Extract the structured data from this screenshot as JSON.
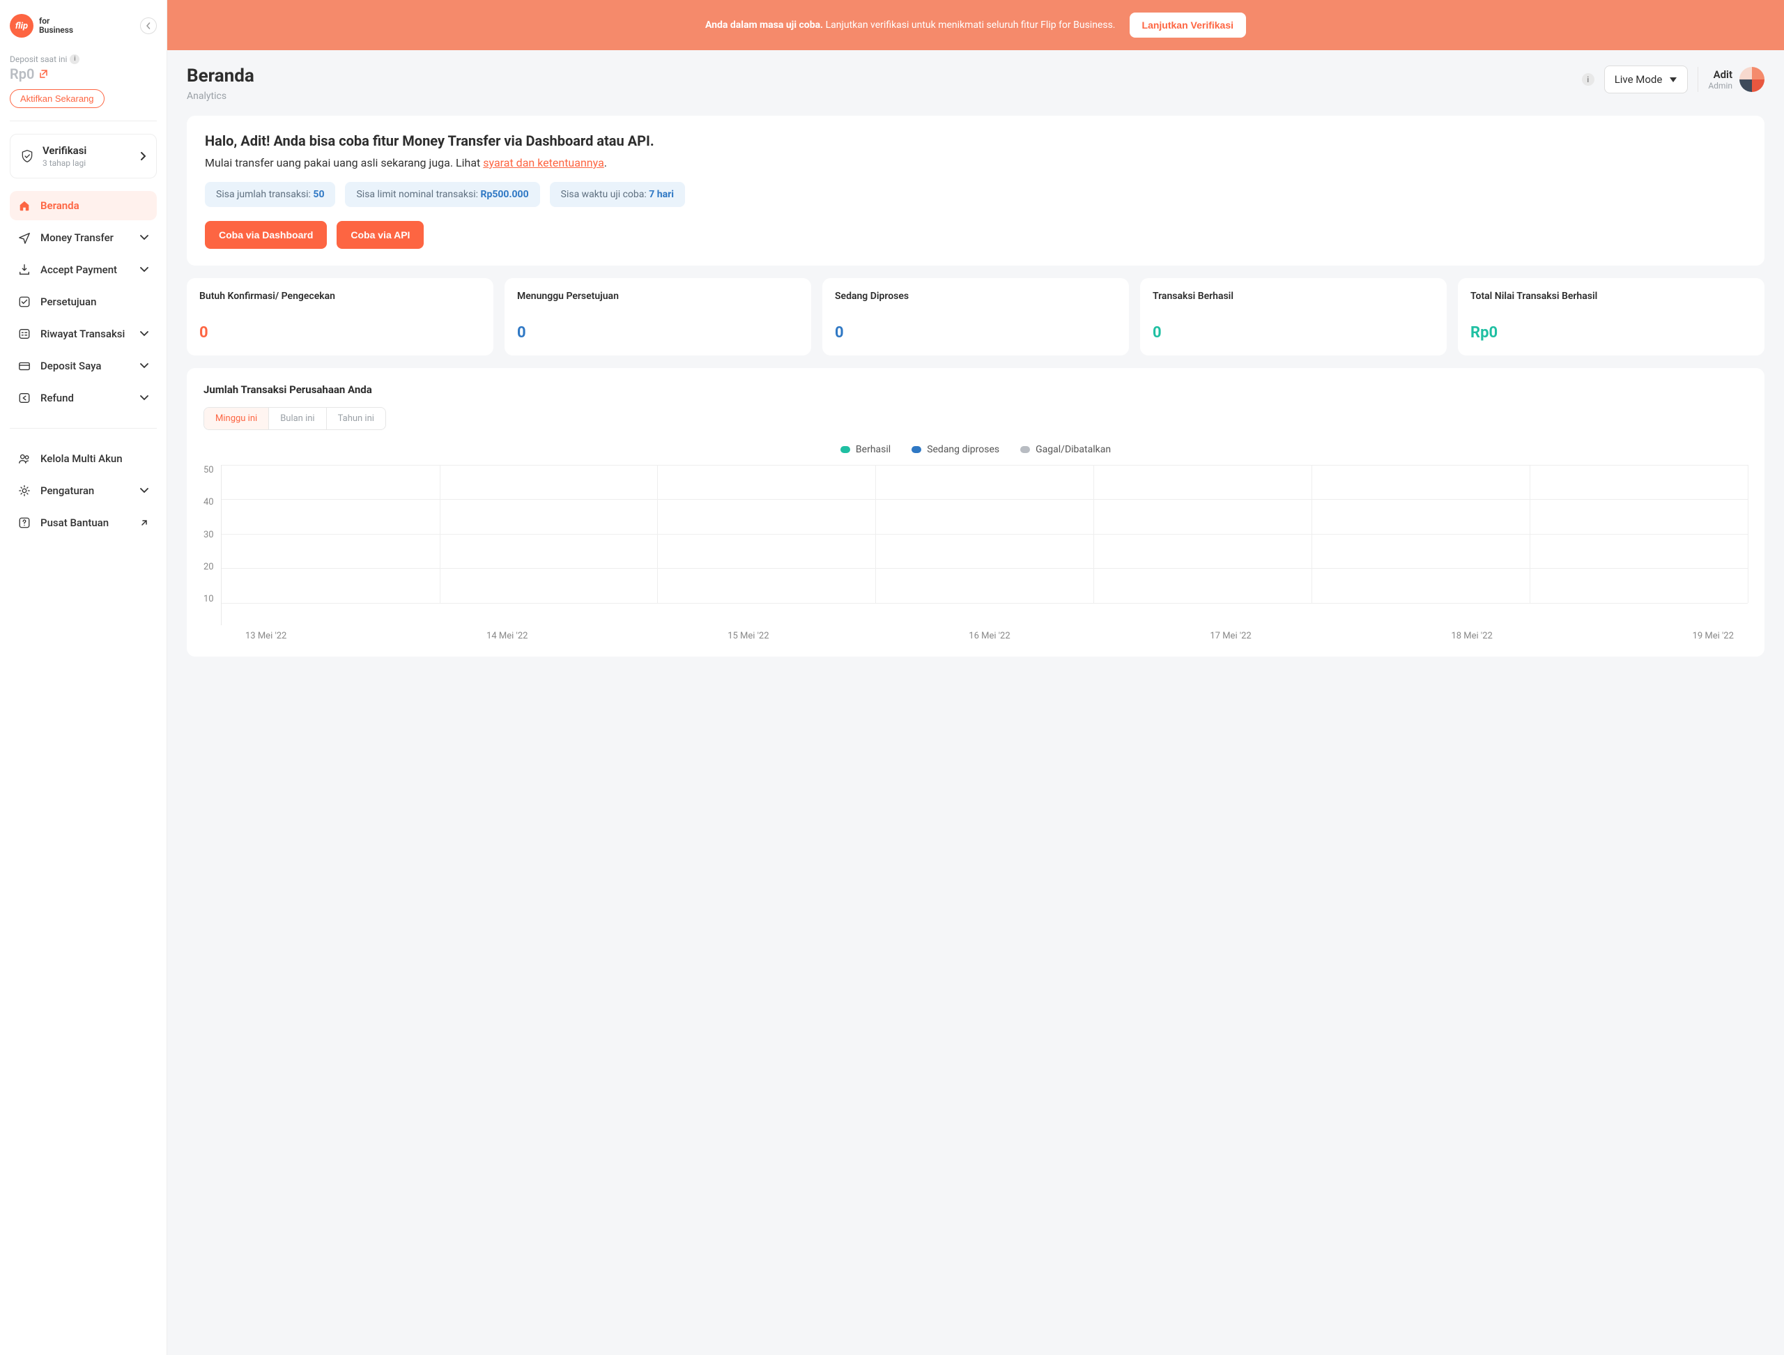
{
  "logo": {
    "badge": "flip",
    "line1": "for",
    "line2": "Business"
  },
  "deposit": {
    "label": "Deposit saat ini",
    "value": "Rp0",
    "activate": "Aktifkan Sekarang"
  },
  "verification": {
    "title": "Verifikasi",
    "subtitle": "3 tahap lagi"
  },
  "nav": {
    "beranda": "Beranda",
    "money": "Money Transfer",
    "accept": "Accept Payment",
    "approval": "Persetujuan",
    "history": "Riwayat Transaksi",
    "deposit": "Deposit Saya",
    "refund": "Refund",
    "multi": "Kelola Multi Akun",
    "settings": "Pengaturan",
    "help": "Pusat Bantuan"
  },
  "banner": {
    "bold": "Anda dalam masa uji coba.",
    "rest": "Lanjutkan verifikasi untuk menikmati seluruh fitur Flip for Business.",
    "cta": "Lanjutkan Verifikasi"
  },
  "header": {
    "title": "Beranda",
    "subtitle": "Analytics",
    "mode": "Live Mode",
    "user_name": "Adit",
    "user_role": "Admin"
  },
  "hello": {
    "title": "Halo, Adit! Anda bisa coba fitur Money Transfer via Dashboard atau API.",
    "sub_pre": "Mulai transfer uang pakai uang asli sekarang juga. Lihat ",
    "sub_link": "syarat dan ketentuannya",
    "sub_post": ".",
    "pill1_label": "Sisa jumlah transaksi: ",
    "pill1_value": "50",
    "pill2_label": "Sisa limit nominal transaksi: ",
    "pill2_value": "Rp500.000",
    "pill3_label": "Sisa waktu uji coba: ",
    "pill3_value": "7 hari",
    "cta1": "Coba via Dashboard",
    "cta2": "Coba via API"
  },
  "stats": [
    {
      "label": "Butuh Konfirmasi/ Pengecekan",
      "value": "0",
      "color": "c-orange"
    },
    {
      "label": "Menunggu Persetujuan",
      "value": "0",
      "color": "c-blue"
    },
    {
      "label": "Sedang Diproses",
      "value": "0",
      "color": "c-blue"
    },
    {
      "label": "Transaksi Berhasil",
      "value": "0",
      "color": "c-teal"
    },
    {
      "label": "Total Nilai Transaksi Berhasil",
      "value": "Rp0",
      "color": "c-teal"
    }
  ],
  "chart": {
    "title": "Jumlah Transaksi Perusahaan Anda",
    "ranges": {
      "week": "Minggu ini",
      "month": "Bulan ini",
      "year": "Tahun ini"
    },
    "legend": {
      "success": "Berhasil",
      "processing": "Sedang diproses",
      "failed": "Gagal/Dibatalkan"
    }
  },
  "chart_data": {
    "type": "line",
    "title": "Jumlah Transaksi Perusahaan Anda",
    "xlabel": "",
    "ylabel": "",
    "ylim": [
      0,
      50
    ],
    "y_ticks": [
      50,
      40,
      30,
      20,
      10
    ],
    "categories": [
      "13 Mei '22",
      "14 Mei '22",
      "15 Mei '22",
      "16 Mei '22",
      "17 Mei '22",
      "18 Mei '22",
      "19 Mei '22"
    ],
    "series": [
      {
        "name": "Berhasil",
        "values": [
          0,
          0,
          0,
          0,
          0,
          0,
          0
        ]
      },
      {
        "name": "Sedang diproses",
        "values": [
          0,
          0,
          0,
          0,
          0,
          0,
          0
        ]
      },
      {
        "name": "Gagal/Dibatalkan",
        "values": [
          0,
          0,
          0,
          0,
          0,
          0,
          0
        ]
      }
    ]
  }
}
